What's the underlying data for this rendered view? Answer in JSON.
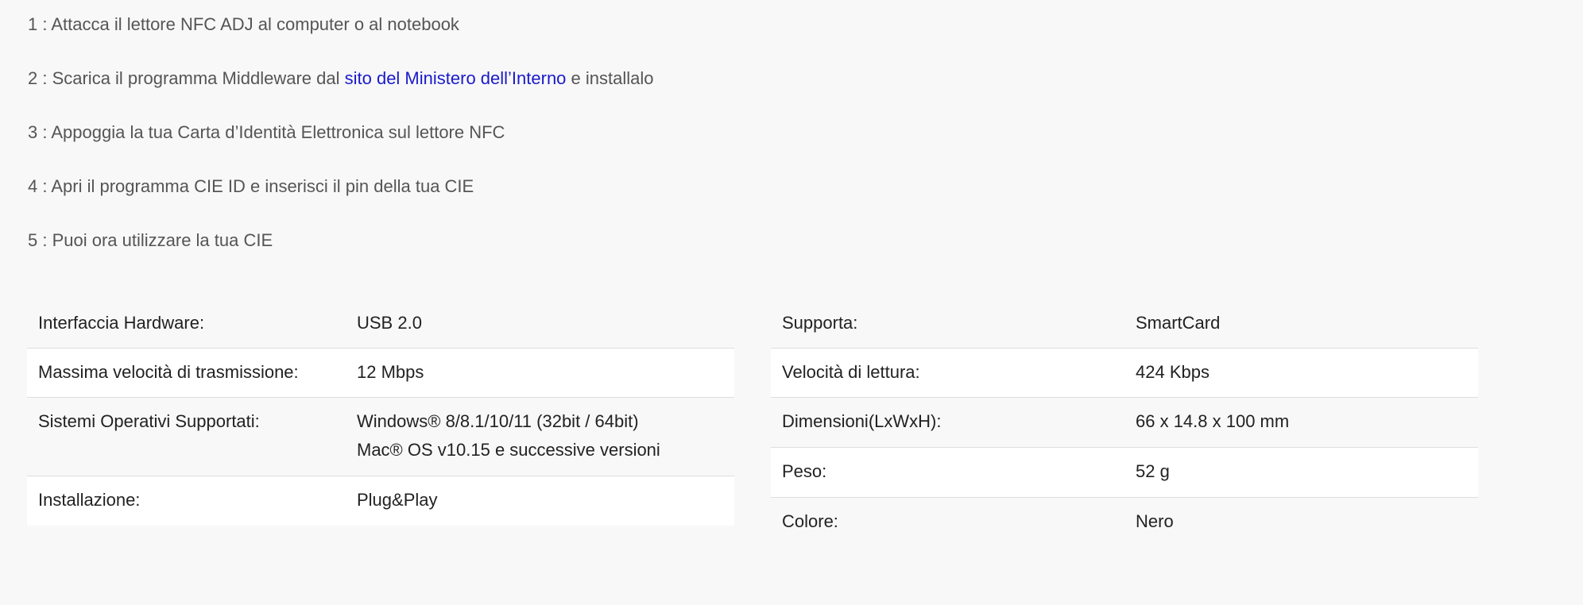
{
  "steps": [
    {
      "text": "1 : Attacca il lettore NFC ADJ al computer o al notebook"
    },
    {
      "prefix": "2 : Scarica il programma Middleware dal ",
      "link": "sito del Ministero dell’Interno",
      "suffix": " e installalo"
    },
    {
      "text": "3 : Appoggia la tua Carta d’Identità Elettronica sul lettore NFC"
    },
    {
      "text": "4 : Apri il programma CIE ID e inserisci il pin della tua CIE"
    },
    {
      "text": "5 : Puoi ora utilizzare la tua CIE"
    }
  ],
  "specs_left": [
    {
      "key": "Interfaccia Hardware:",
      "value": "USB 2.0"
    },
    {
      "key": "Massima velocità di trasmissione:",
      "value": "12 Mbps"
    },
    {
      "key": "Sistemi Operativi Supportati:",
      "value": "Windows® 8/8.1/10/11 (32bit / 64bit)",
      "value2": "Mac® OS v10.15 e successive versioni"
    },
    {
      "key": "Installazione:",
      "value": "Plug&Play"
    }
  ],
  "specs_right": [
    {
      "key": "Supporta:",
      "value": "SmartCard"
    },
    {
      "key": "Velocità di lettura:",
      "value": "424 Kbps"
    },
    {
      "key": "Dimensioni(LxWxH):",
      "value": "66 x 14.8 x 100 mm"
    },
    {
      "key": "Peso:",
      "value": "52 g"
    },
    {
      "key": "Colore:",
      "value": "Nero"
    }
  ],
  "colors": {
    "background": "#f8f8f8",
    "link": "#1a1acb",
    "step_text": "#555555",
    "table_text": "#222222"
  }
}
